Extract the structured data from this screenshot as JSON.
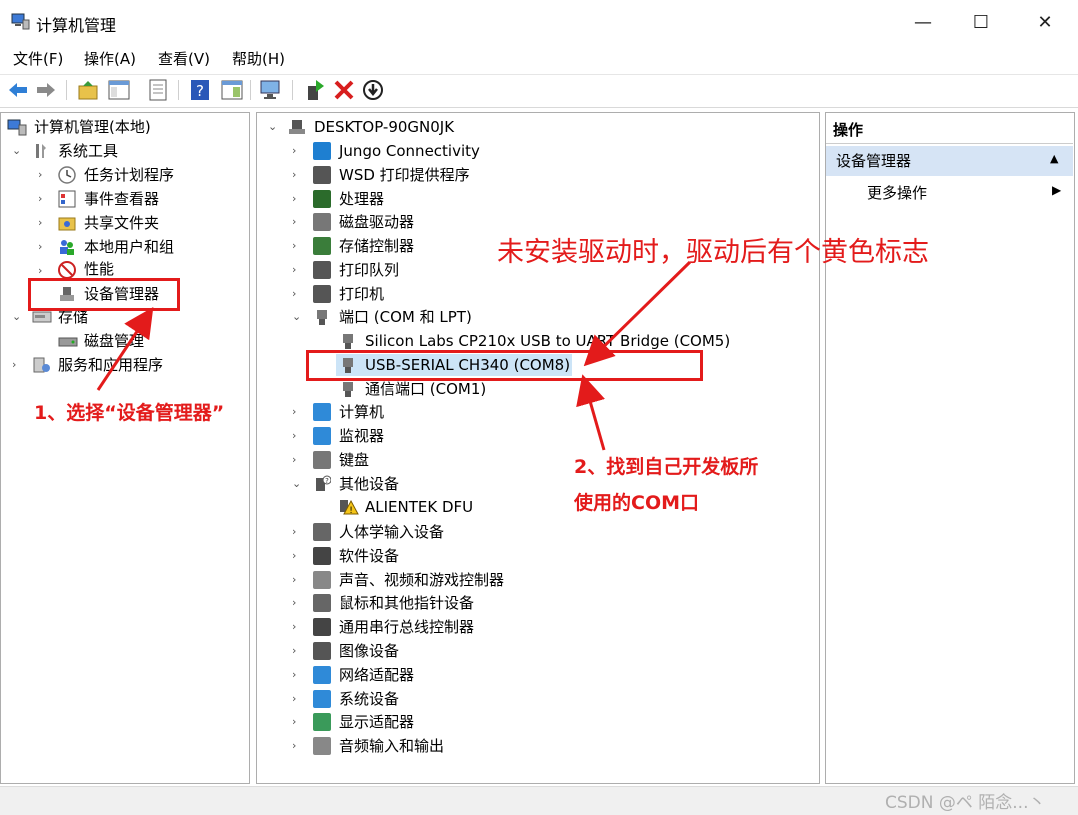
{
  "window": {
    "title": "计算机管理",
    "min_label": "—",
    "max_label": "☐",
    "close_label": "✕"
  },
  "menu": [
    "文件(F)",
    "操作(A)",
    "查看(V)",
    "帮助(H)"
  ],
  "left_tree": {
    "root": "计算机管理(本地)",
    "system_tools": "系统工具",
    "task_scheduler": "任务计划程序",
    "event_viewer": "事件查看器",
    "shared_folders": "共享文件夹",
    "local_users": "本地用户和组",
    "performance": "性能",
    "device_manager": "设备管理器",
    "storage": "存储",
    "disk_management": "磁盘管理",
    "services": "服务和应用程序"
  },
  "device_tree": {
    "root": "DESKTOP-90GN0JK",
    "items": [
      {
        "label": "Jungo Connectivity",
        "icon": "usb-device-icon",
        "color": "#1e7fd1"
      },
      {
        "label": "WSD 打印提供程序",
        "icon": "printer-icon",
        "color": "#555555"
      },
      {
        "label": "处理器",
        "icon": "processor-icon",
        "color": "#2b6b2b"
      },
      {
        "label": "磁盘驱动器",
        "icon": "disk-drive-icon",
        "color": "#777777"
      },
      {
        "label": "存储控制器",
        "icon": "storage-controller-icon",
        "color": "#3a7d3a"
      },
      {
        "label": "打印队列",
        "icon": "print-queue-icon",
        "color": "#555555"
      },
      {
        "label": "打印机",
        "icon": "printer-icon",
        "color": "#555555"
      }
    ],
    "ports": {
      "label": "端口 (COM 和 LPT)",
      "children": [
        "Silicon Labs CP210x USB to UART Bridge (COM5)",
        "USB-SERIAL CH340 (COM8)",
        "通信端口 (COM1)"
      ]
    },
    "items2": [
      {
        "label": "计算机",
        "icon": "computer-icon",
        "color": "#2f8ad8"
      },
      {
        "label": "监视器",
        "icon": "monitor-icon",
        "color": "#2f8ad8"
      },
      {
        "label": "键盘",
        "icon": "keyboard-icon",
        "color": "#777777"
      }
    ],
    "other": {
      "label": "其他设备",
      "child": "ALIENTEK DFU"
    },
    "items3": [
      {
        "label": "人体学输入设备",
        "icon": "hid-icon",
        "color": "#666666"
      },
      {
        "label": "软件设备",
        "icon": "software-device-icon",
        "color": "#444444"
      },
      {
        "label": "声音、视频和游戏控制器",
        "icon": "speaker-icon",
        "color": "#888888"
      },
      {
        "label": "鼠标和其他指针设备",
        "icon": "mouse-icon",
        "color": "#666666"
      },
      {
        "label": "通用串行总线控制器",
        "icon": "usb-icon",
        "color": "#444444"
      },
      {
        "label": "图像设备",
        "icon": "camera-icon",
        "color": "#555555"
      },
      {
        "label": "网络适配器",
        "icon": "network-adapter-icon",
        "color": "#2f8ad8"
      },
      {
        "label": "系统设备",
        "icon": "system-device-icon",
        "color": "#2f8ad8"
      },
      {
        "label": "显示适配器",
        "icon": "display-adapter-icon",
        "color": "#3a9a5a"
      },
      {
        "label": "音频输入和输出",
        "icon": "audio-icon",
        "color": "#888888"
      }
    ]
  },
  "actions": {
    "header": "操作",
    "section": "设备管理器",
    "more": "更多操作"
  },
  "annotations": {
    "step1": "1、选择“设备管理器”",
    "driver_note": "未安装驱动时，驱动后有个黄色标志",
    "step2_line1": "2、找到自己开发板所",
    "step2_line2": "使用的COM口"
  },
  "watermark": "CSDN @ペ 陌念...丶",
  "colors": {
    "annotation": "#e31b1b",
    "selection": "#cce4f7",
    "action_section": "#d6e4f5"
  }
}
